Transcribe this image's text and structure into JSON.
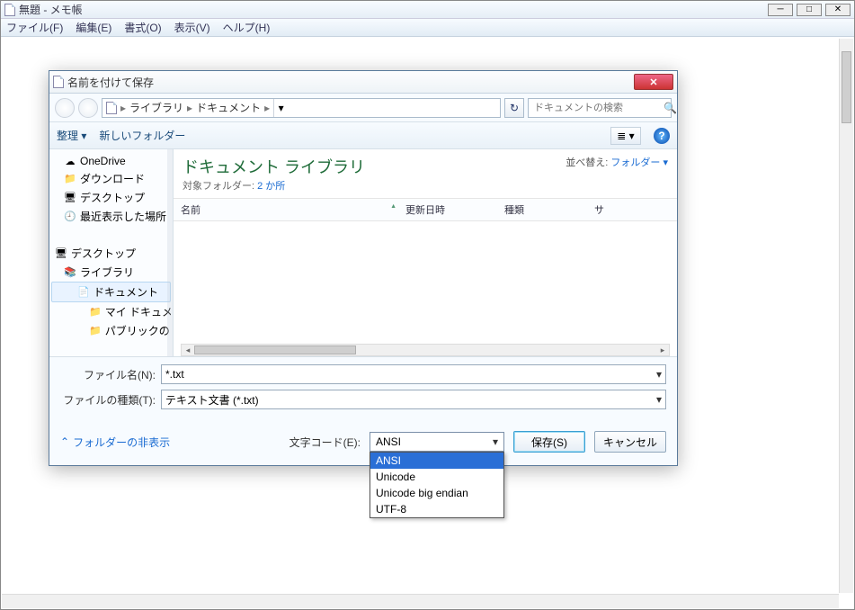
{
  "outer": {
    "title": "無題 - メモ帳",
    "min": "─",
    "max": "□",
    "close": "✕"
  },
  "menubar": {
    "file": "ファイル(F)",
    "edit": "編集(E)",
    "format": "書式(O)",
    "view": "表示(V)",
    "help": "ヘルプ(H)"
  },
  "dialog": {
    "title": "名前を付けて保存",
    "close_glyph": "✕",
    "breadcrumb": {
      "c1": "ライブラリ",
      "c2": "ドキュメント",
      "sep": "▸"
    },
    "refresh_glyph": "↻",
    "search_placeholder": "ドキュメントの検索",
    "search_icon": "🔍",
    "toolbar": {
      "organize": "整理 ▾",
      "new_folder": "新しいフォルダー",
      "view_glyph": "≣ ▾",
      "help": "?"
    },
    "sidebar": {
      "onedrive": "OneDrive",
      "downloads": "ダウンロード",
      "desktop_fav": "デスクトップ",
      "recent": "最近表示した場所",
      "desktop": "デスクトップ",
      "libraries": "ライブラリ",
      "documents": "ドキュメント",
      "my_docs": "マイ ドキュメ",
      "public": "パブリックの"
    },
    "library": {
      "title": "ドキュメント ライブラリ",
      "sub_label": "対象フォルダー: ",
      "sub_link": "2 か所",
      "arrange_label": "並べ替え:",
      "arrange_value": "フォルダー ▾"
    },
    "columns": {
      "name": "名前",
      "date": "更新日時",
      "type": "種類",
      "size": "サ"
    },
    "filename_label": "ファイル名(N):",
    "filename_value": "*.txt",
    "filetype_label": "ファイルの種類(T):",
    "filetype_value": "テキスト文書 (*.txt)",
    "folder_toggle": "フォルダーの非表示",
    "folder_toggle_glyph": "⌃",
    "encoding_label": "文字コード(E):",
    "encoding_value": "ANSI",
    "encoding_options": [
      "ANSI",
      "Unicode",
      "Unicode big endian",
      "UTF-8"
    ],
    "save_btn": "保存(S)",
    "cancel_btn": "キャンセル"
  }
}
